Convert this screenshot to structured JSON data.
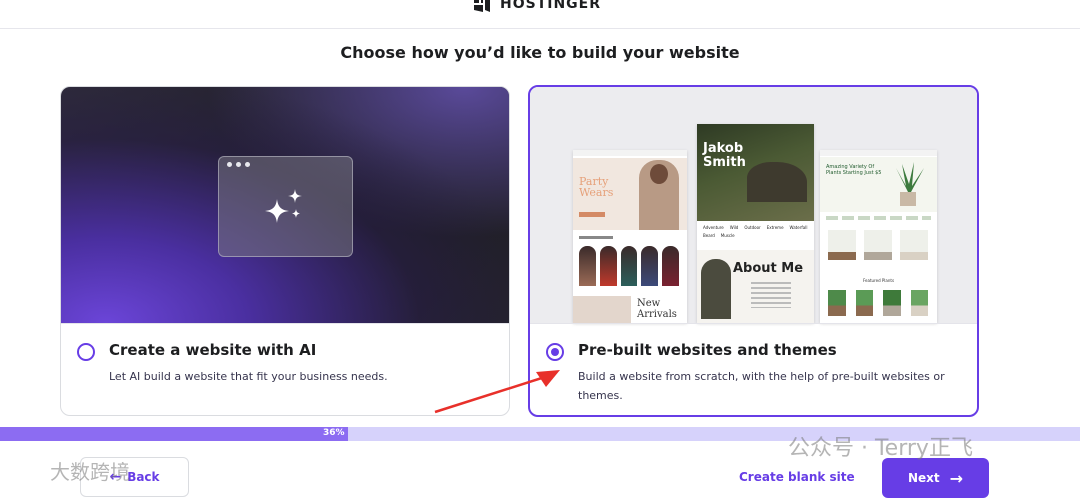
{
  "header": {
    "brand": "HOSTINGER"
  },
  "headline": "Choose how you’d like to build your website",
  "options": [
    {
      "title": "Create a website with AI",
      "description": "Let AI build a website that fit your business needs.",
      "selected": false
    },
    {
      "title": "Pre-built websites and themes",
      "description": "Build a website from scratch, with the help of pre-built websites or themes.",
      "selected": true
    }
  ],
  "templates": {
    "left": {
      "headline": "Party Wears",
      "sub": "New Arrivals"
    },
    "center": {
      "headline": "Jakob Smith",
      "section": "About Me",
      "tags": [
        "Adventure",
        "Wild",
        "Outdoor",
        "Extreme",
        "Waterfall",
        "Beard",
        "Muscle"
      ]
    },
    "right": {
      "headline": "Amazing Variety Of Plants Starting Just $5",
      "section": "Featured Plants"
    }
  },
  "progress": {
    "value": 36,
    "label": "36%"
  },
  "footer": {
    "back_label": "Back",
    "blank_label": "Create blank site",
    "next_label": "Next"
  },
  "watermarks": {
    "left": "大数跨境",
    "right": "公众号 · Terry正飞"
  },
  "colors": {
    "accent": "#673de6",
    "annotation": "#e8302a"
  }
}
